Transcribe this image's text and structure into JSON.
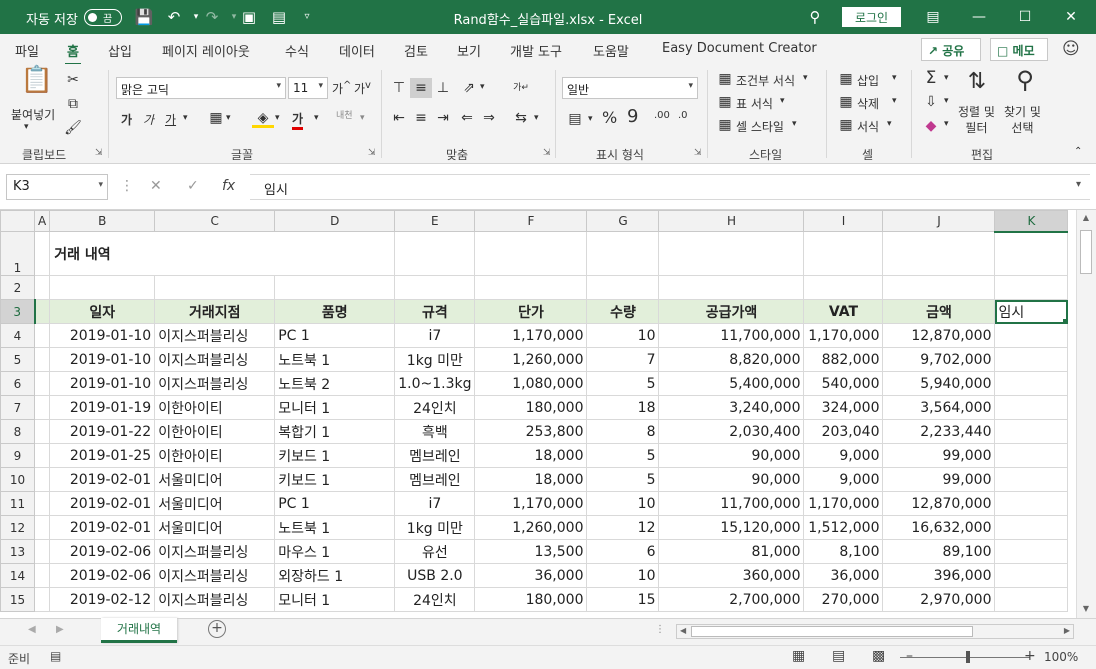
{
  "titlebar": {
    "autosave_label": "자동 저장",
    "autosave_state": "끔",
    "doc_title": "Rand함수_실습파일.xlsx  -  Excel",
    "login_label": "로그인"
  },
  "menu": {
    "tabs": [
      "파일",
      "홈",
      "삽입",
      "페이지 레이아웃",
      "수식",
      "데이터",
      "검토",
      "보기",
      "개발 도구",
      "도움말",
      "Easy Document Creator"
    ],
    "active_index": 1,
    "share_label": "공유",
    "memo_label": "메모"
  },
  "ribbon": {
    "clipboard": {
      "paste_label": "붙여넣기",
      "group_label": "클립보드"
    },
    "font": {
      "font_name": "맑은 고딕",
      "font_size": "11",
      "group_label": "글꼴"
    },
    "alignment": {
      "group_label": "맞춤"
    },
    "number": {
      "format": "일반",
      "group_label": "표시 형식"
    },
    "styles": {
      "conditional": "조건부 서식",
      "table": "표 서식",
      "cell_style": "셀 스타일",
      "group_label": "스타일"
    },
    "cells": {
      "insert": "삽입",
      "delete": "삭제",
      "format": "서식",
      "group_label": "셀"
    },
    "editing": {
      "sort_filter": "정렬 및\n필터",
      "find_select": "찾기 및\n선택",
      "group_label": "편집"
    }
  },
  "formula_bar": {
    "name_box": "K3",
    "formula": "임시"
  },
  "sheet": {
    "columns": [
      "A",
      "B",
      "C",
      "D",
      "E",
      "F",
      "G",
      "H",
      "I",
      "J",
      "K"
    ],
    "selected_column": "K",
    "selected_row": 3,
    "title": "거래 내역",
    "headers": [
      "일자",
      "거래지점",
      "품명",
      "규격",
      "단가",
      "수량",
      "공급가액",
      "VAT",
      "금액",
      "임시"
    ],
    "rows": [
      {
        "n": 4,
        "cells": [
          "2019-01-10",
          "이지스퍼블리싱",
          "PC 1",
          "i7",
          "1,170,000",
          "10",
          "11,700,000",
          "1,170,000",
          "12,870,000"
        ]
      },
      {
        "n": 5,
        "cells": [
          "2019-01-10",
          "이지스퍼블리싱",
          "노트북 1",
          "1kg 미만",
          "1,260,000",
          "7",
          "8,820,000",
          "882,000",
          "9,702,000"
        ]
      },
      {
        "n": 6,
        "cells": [
          "2019-01-10",
          "이지스퍼블리싱",
          "노트북 2",
          "1.0~1.3kg",
          "1,080,000",
          "5",
          "5,400,000",
          "540,000",
          "5,940,000"
        ]
      },
      {
        "n": 7,
        "cells": [
          "2019-01-19",
          "이한아이티",
          "모니터 1",
          "24인치",
          "180,000",
          "18",
          "3,240,000",
          "324,000",
          "3,564,000"
        ]
      },
      {
        "n": 8,
        "cells": [
          "2019-01-22",
          "이한아이티",
          "복합기 1",
          "흑백",
          "253,800",
          "8",
          "2,030,400",
          "203,040",
          "2,233,440"
        ]
      },
      {
        "n": 9,
        "cells": [
          "2019-01-25",
          "이한아이티",
          "키보드 1",
          "멤브레인",
          "18,000",
          "5",
          "90,000",
          "9,000",
          "99,000"
        ]
      },
      {
        "n": 10,
        "cells": [
          "2019-02-01",
          "서울미디어",
          "키보드 1",
          "멤브레인",
          "18,000",
          "5",
          "90,000",
          "9,000",
          "99,000"
        ]
      },
      {
        "n": 11,
        "cells": [
          "2019-02-01",
          "서울미디어",
          "PC 1",
          "i7",
          "1,170,000",
          "10",
          "11,700,000",
          "1,170,000",
          "12,870,000"
        ]
      },
      {
        "n": 12,
        "cells": [
          "2019-02-01",
          "서울미디어",
          "노트북 1",
          "1kg 미만",
          "1,260,000",
          "12",
          "15,120,000",
          "1,512,000",
          "16,632,000"
        ]
      },
      {
        "n": 13,
        "cells": [
          "2019-02-06",
          "이지스퍼블리싱",
          "마우스 1",
          "유선",
          "13,500",
          "6",
          "81,000",
          "8,100",
          "89,100"
        ]
      },
      {
        "n": 14,
        "cells": [
          "2019-02-06",
          "이지스퍼블리싱",
          "외장하드 1",
          "USB 2.0",
          "36,000",
          "10",
          "360,000",
          "36,000",
          "396,000"
        ]
      },
      {
        "n": 15,
        "cells": [
          "2019-02-12",
          "이지스퍼블리싱",
          "모니터 1",
          "24인치",
          "180,000",
          "15",
          "2,700,000",
          "270,000",
          "2,970,000"
        ]
      }
    ]
  },
  "tabs": {
    "sheet_name": "거래내역"
  },
  "status": {
    "ready": "준비",
    "zoom": "100%"
  },
  "colors": {
    "accent": "#217346",
    "header_fill": "#e2efda"
  }
}
